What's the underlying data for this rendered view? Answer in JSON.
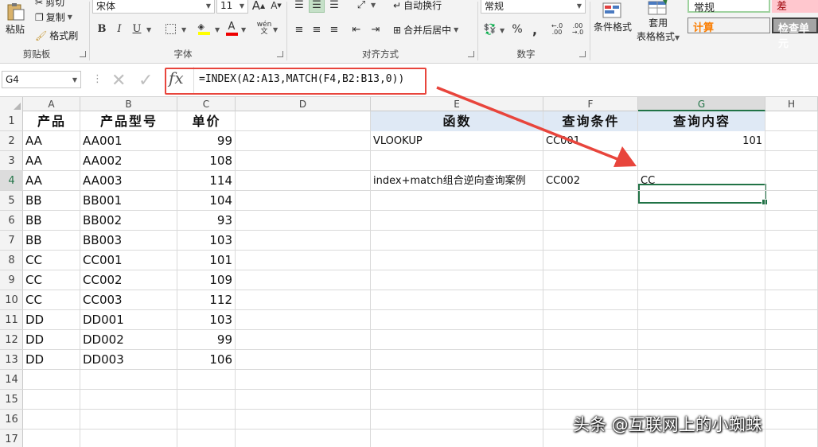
{
  "ribbon": {
    "clipboard": {
      "paste": "粘贴",
      "cut": "剪切",
      "copy": "复制",
      "format_painter": "格式刷",
      "label": "剪贴板"
    },
    "font": {
      "font_name": "宋体",
      "font_size": "11",
      "bold": "B",
      "italic": "I",
      "underline": "U",
      "grow": "A",
      "shrink": "A",
      "phonetic": "wén",
      "label": "字体"
    },
    "alignment": {
      "wrap_text": "自动换行",
      "merge_center": "合并后居中",
      "label": "对齐方式"
    },
    "number": {
      "format": "常规",
      "percent": "%",
      "comma": ",",
      "inc_decimal": "←.0 .00",
      "dec_decimal": ".00 →.0",
      "label": "数字"
    },
    "styles": {
      "conditional_formatting": "条件格式",
      "format_as_table_1": "套用",
      "format_as_table_2": "表格格式",
      "normal": "常规",
      "bad": "差",
      "calculation": "计算",
      "check_cell": "检查单元"
    }
  },
  "formula_bar": {
    "name_box": "G4",
    "cancel_glyph": "✕",
    "enter_glyph": "✓",
    "fx_label": "fx",
    "formula": "=INDEX(A2:A13,MATCH(F4,B2:B13,0))"
  },
  "colors": {
    "accent": "#217346",
    "highlight": "#e8453c",
    "header_fill": "#dfe9f5"
  },
  "columns": [
    "A",
    "B",
    "C",
    "D",
    "E",
    "F",
    "G",
    "H"
  ],
  "rows": [
    "1",
    "2",
    "3",
    "4",
    "5",
    "6",
    "7",
    "8",
    "9",
    "10",
    "11",
    "12",
    "13",
    "14",
    "15",
    "16",
    "17"
  ],
  "active_column": "G",
  "active_row": "4",
  "table_left": {
    "headers": [
      "产品",
      "产品型号",
      "单价"
    ],
    "data": [
      [
        "AA",
        "AA001",
        "99"
      ],
      [
        "AA",
        "AA002",
        "108"
      ],
      [
        "AA",
        "AA003",
        "114"
      ],
      [
        "BB",
        "BB001",
        "104"
      ],
      [
        "BB",
        "BB002",
        "93"
      ],
      [
        "BB",
        "BB003",
        "103"
      ],
      [
        "CC",
        "CC001",
        "101"
      ],
      [
        "CC",
        "CC002",
        "109"
      ],
      [
        "CC",
        "CC003",
        "112"
      ],
      [
        "DD",
        "DD001",
        "103"
      ],
      [
        "DD",
        "DD002",
        "99"
      ],
      [
        "DD",
        "DD003",
        "106"
      ]
    ]
  },
  "table_right": {
    "headers": [
      "函数",
      "查询条件",
      "查询内容"
    ],
    "rows": [
      [
        "VLOOKUP",
        "CC001",
        "101"
      ],
      [
        "",
        "",
        ""
      ],
      [
        "index+match组合逆向查询案例",
        "CC002",
        "CC"
      ]
    ]
  },
  "watermark": "头条 @互联网上的小蜘蛛"
}
